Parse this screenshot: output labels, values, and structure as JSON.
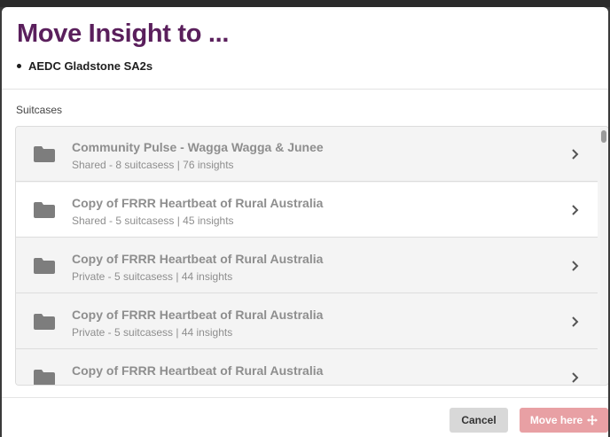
{
  "modal": {
    "title": "Move Insight to ...",
    "items": [
      "AEDC Gladstone SA2s"
    ]
  },
  "section": {
    "label": "Suitcases"
  },
  "suitcases": [
    {
      "title": "Community Pulse - Wagga Wagga & Junee",
      "subtitle": "Shared - 8 suitcasess | 76 insights"
    },
    {
      "title": "Copy of FRRR Heartbeat of Rural Australia",
      "subtitle": "Shared - 5 suitcasess | 45 insights"
    },
    {
      "title": "Copy of FRRR Heartbeat of Rural Australia",
      "subtitle": "Private - 5 suitcasess | 44 insights"
    },
    {
      "title": "Copy of FRRR Heartbeat of Rural Australia",
      "subtitle": "Private - 5 suitcasess | 44 insights"
    },
    {
      "title": "Copy of FRRR Heartbeat of Rural Australia",
      "subtitle": ""
    }
  ],
  "footer": {
    "cancel_label": "Cancel",
    "move_label": "Move here"
  },
  "icons": {
    "row": "folder-icon",
    "row_action": "chevron-right-icon",
    "move": "move-arrows-icon"
  },
  "colors": {
    "title": "#5a1f5c",
    "primary_button": "#e8a0a4",
    "secondary_button": "#d8d8d8"
  }
}
